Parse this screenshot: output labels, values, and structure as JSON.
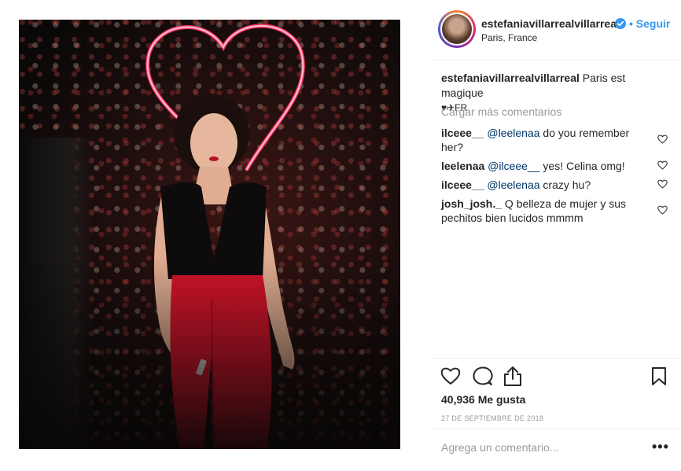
{
  "post": {
    "username": "estefaniavillarrealvillarreal",
    "follow_label": "Seguir",
    "location": "Paris, France"
  },
  "caption": {
    "username": "estefaniavillarrealvillarreal",
    "text": "Paris est magique",
    "emoji_line": "♥✈FR"
  },
  "load_more_label": "Cargar más comentarios",
  "comments": [
    {
      "user": "ilceee__",
      "mention": "@leelenaa",
      "text": " do you remember her?"
    },
    {
      "user": "leelenaa",
      "mention": "@ilceee__",
      "text": " yes! Celina omg!"
    },
    {
      "user": "ilceee__",
      "mention": "@leelenaa",
      "text": " crazy hu?"
    },
    {
      "user": "josh_josh._",
      "mention": "",
      "text": "Q belleza de mujer y sus pechitos bien lucidos mmmm"
    }
  ],
  "likes_text": "40,936 Me gusta",
  "date_text": "27 DE SEPTIEMBRE DE 2018",
  "comment_input": {
    "placeholder": "Agrega un comentario...",
    "value": ""
  },
  "more_label": "•••",
  "colors": {
    "accent": "#3897f0",
    "muted": "#999999",
    "text": "#262626",
    "border": "#efefef",
    "mention": "#003569"
  }
}
